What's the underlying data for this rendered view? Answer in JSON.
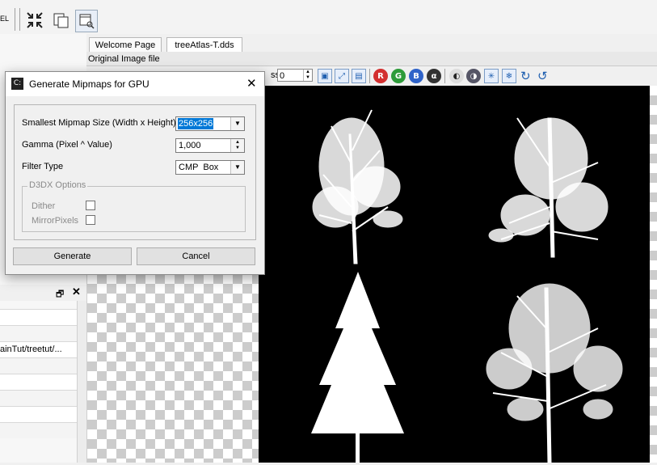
{
  "toolbar": {
    "left_label": "EL"
  },
  "tabs": [
    {
      "label": "Welcome Page"
    },
    {
      "label": "treeAtlas-T.dds"
    }
  ],
  "image_header": {
    "label": "Original Image file"
  },
  "image_toolbar": {
    "field_label": "ss:",
    "field_value": "0",
    "channel_buttons": [
      "R",
      "G",
      "B"
    ]
  },
  "left_panel": {
    "path_text": "ainTut/treetut/..."
  },
  "dialog": {
    "title": "Generate Mipmaps for GPU",
    "smallest_size_label": "Smallest Mipmap Size (Width x Height)",
    "smallest_size_value": "256x256",
    "gamma_label": "Gamma (Pixel ^ Value)",
    "gamma_value": "1,000",
    "filter_label": "Filter Type",
    "filter_value": "CMP  Box",
    "group_label": "D3DX Options",
    "dither_label": "Dither",
    "mirror_label": "MirrorPixels",
    "generate_label": "Generate",
    "cancel_label": "Cancel"
  },
  "colors": {
    "accent": "#0078d7",
    "red": "#d32f2f",
    "green": "#2e9b3a",
    "blue": "#2f63c9"
  }
}
